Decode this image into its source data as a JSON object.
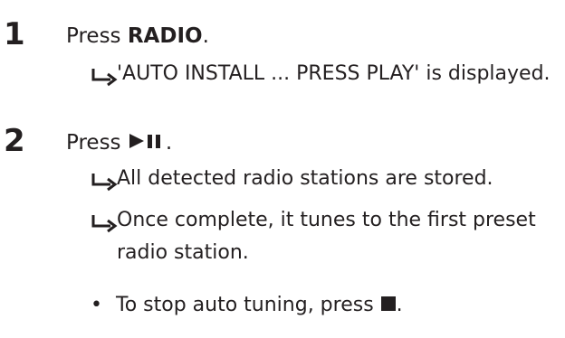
{
  "steps": [
    {
      "number": "1",
      "prefix": "Press ",
      "emphasis": "RADIO",
      "suffix": ".",
      "results": [
        "'AUTO INSTALL ... PRESS PLAY' is displayed."
      ]
    },
    {
      "number": "2",
      "prefix": "Press ",
      "button_icon": "play-pause-icon",
      "suffix": ".",
      "results": [
        "All detected radio stations are stored.",
        "Once complete, it tunes to the first preset radio station."
      ],
      "note": {
        "bullet": "•",
        "text": "To stop auto tuning, press ",
        "button_icon": "stop-icon",
        "suffix": "."
      }
    }
  ],
  "icons": {
    "result_arrow": "result-arrow-icon"
  }
}
